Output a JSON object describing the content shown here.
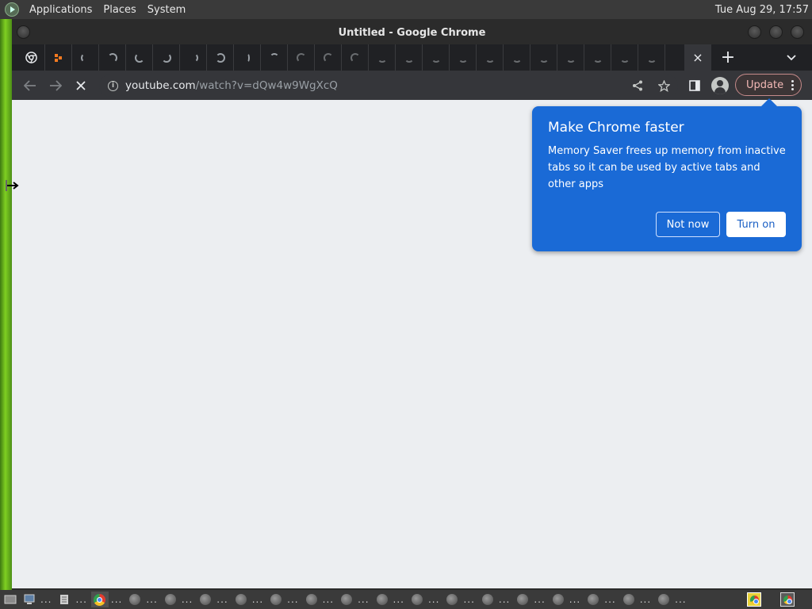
{
  "top_panel": {
    "menus": [
      "Applications",
      "Places",
      "System"
    ],
    "clock": "Tue Aug 29, 17:57"
  },
  "window": {
    "title": "Untitled - Google Chrome"
  },
  "tabs": {
    "count_visible": 25,
    "active_tab_close_symbol": "×",
    "new_tab_symbol": "+"
  },
  "toolbar": {
    "url_host": "youtube.com",
    "url_path": "/watch?v=dQw4w9WgXcQ",
    "update_label": "Update"
  },
  "bubble": {
    "title": "Make Chrome faster",
    "body": "Memory Saver frees up memory from inactive tabs so it can be used by active tabs and other apps",
    "not_now": "Not now",
    "turn_on": "Turn on"
  },
  "taskbar": {
    "dots": "..."
  },
  "colors": {
    "bubble_blue": "#1a6ad6",
    "page_bg": "#eceef1",
    "toolbar_bg": "#35363a",
    "update_accent": "#f2b8b5"
  }
}
